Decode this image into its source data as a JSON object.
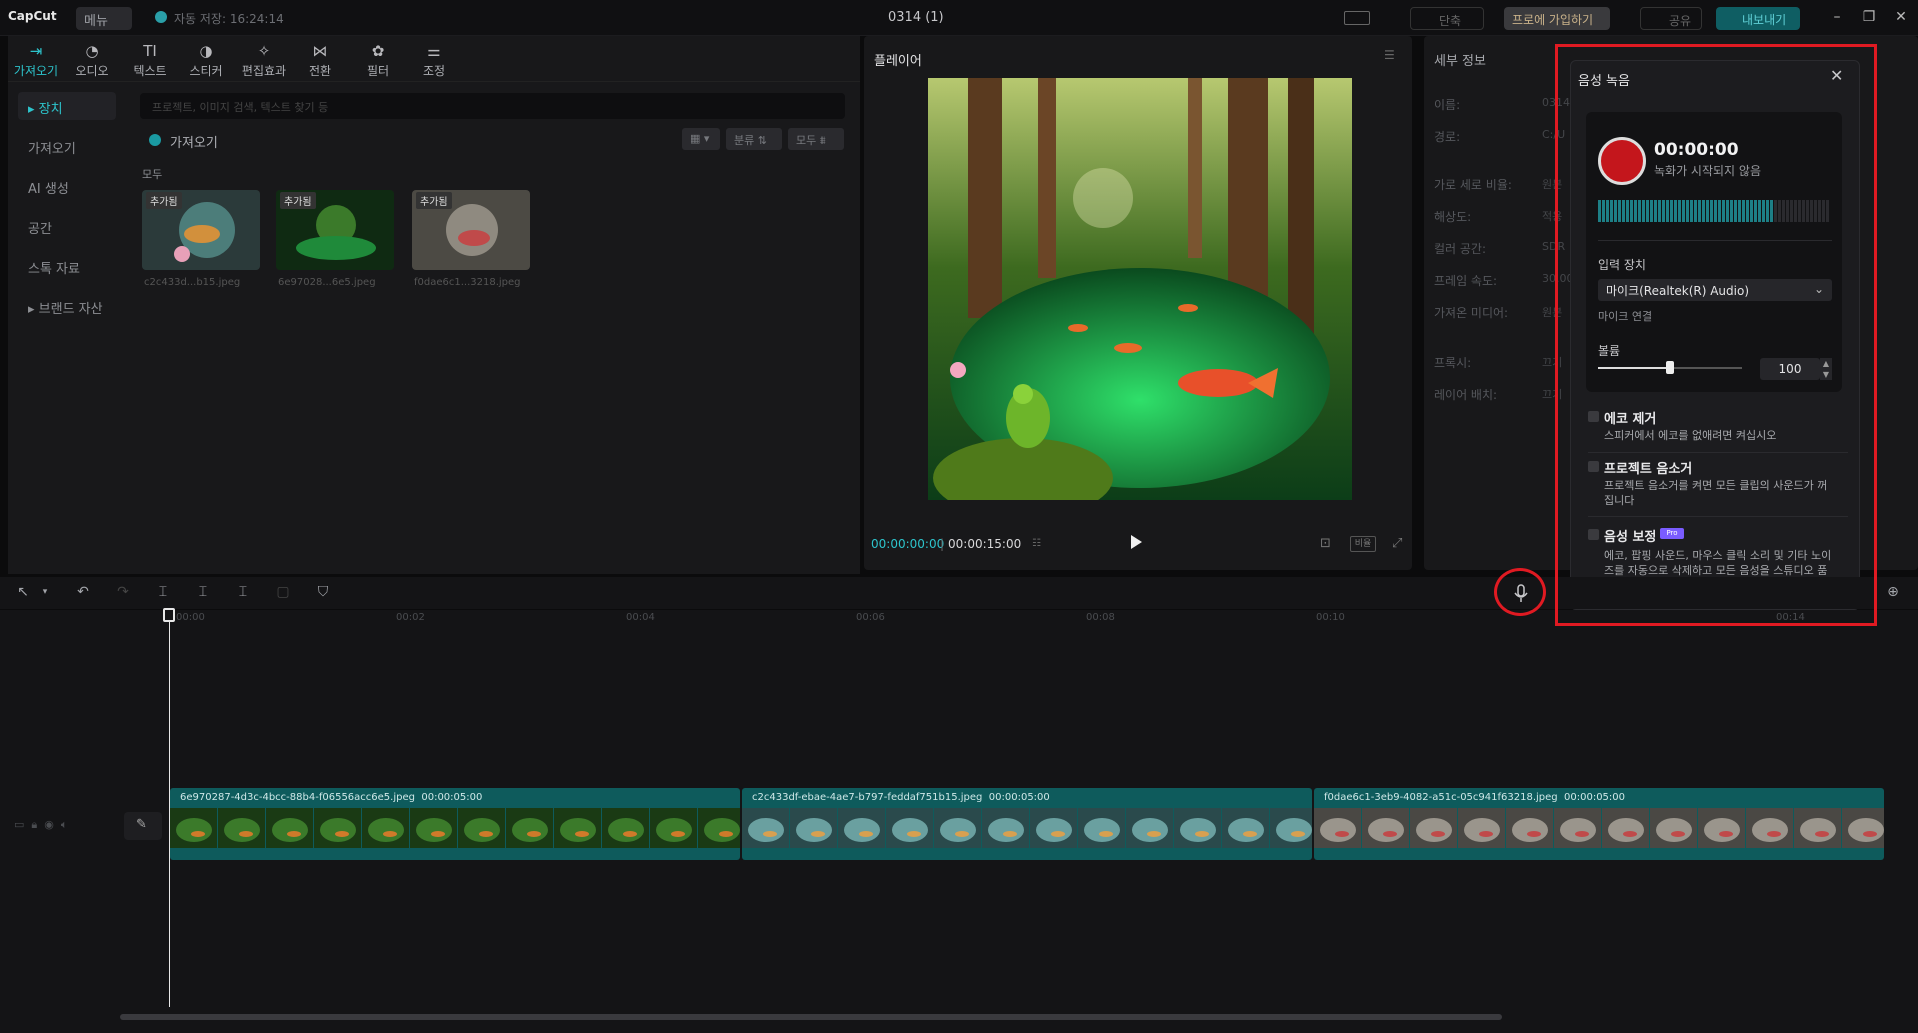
{
  "titlebar": {
    "logo": "CapCut",
    "menu_label": "메뉴",
    "autosave": "자동 저장: 16:24:14",
    "project_title": "0314 (1)",
    "shortcut_label": "단축",
    "pro_label": "프로에 가입하기",
    "share_label": "공유",
    "export_label": "내보내기"
  },
  "toptabs": [
    {
      "label": "가져오기",
      "icon": "import-icon"
    },
    {
      "label": "오디오",
      "icon": "audio-icon"
    },
    {
      "label": "텍스트",
      "icon": "text-icon"
    },
    {
      "label": "스티커",
      "icon": "sticker-icon"
    },
    {
      "label": "편집효과",
      "icon": "effects-icon"
    },
    {
      "label": "전환",
      "icon": "transition-icon"
    },
    {
      "label": "필터",
      "icon": "filter-icon"
    },
    {
      "label": "조정",
      "icon": "adjust-icon"
    }
  ],
  "sidebar": [
    {
      "label": "▸ 장치"
    },
    {
      "label": "가져오기"
    },
    {
      "label": "AI 생성"
    },
    {
      "label": "공간"
    },
    {
      "label": "스톡 자료"
    },
    {
      "label": "▸ 브랜드 자산"
    }
  ],
  "media": {
    "search_placeholder": "프로젝트, 이미지 검색, 텍스트 찾기 등",
    "import_label": "가져오기",
    "sort_label": "분류",
    "filter_label": "모두",
    "all_label": "모두",
    "items": [
      {
        "badge": "추가됨",
        "name": "c2c433d...b15.jpeg"
      },
      {
        "badge": "추가됨",
        "name": "6e97028...6e5.jpeg"
      },
      {
        "badge": "추가됨",
        "name": "f0dae6c1...3218.jpeg"
      }
    ]
  },
  "player": {
    "title": "플레이어",
    "current_time": "00:00:00:00",
    "total_time": "00:00:15:00",
    "ratio_label": "비율"
  },
  "details": {
    "title": "세부 정보",
    "rows": [
      {
        "label": "이름:",
        "value": "0314"
      },
      {
        "label": "경로:",
        "value": "C:/U"
      },
      {
        "label": "가로 세로 비율:",
        "value": "원본"
      },
      {
        "label": "해상도:",
        "value": "적용"
      },
      {
        "label": "컬러 공간:",
        "value": "SDR"
      },
      {
        "label": "프레임 속도:",
        "value": "30.00"
      },
      {
        "label": "가져온 미디어:",
        "value": "원본"
      },
      {
        "label": "프록시:",
        "value": "끄기"
      },
      {
        "label": "레이어 배치:",
        "value": "끄기"
      }
    ]
  },
  "voice_record": {
    "title": "음성 녹음",
    "time": "00:00:00",
    "status": "녹화가 시작되지 않음",
    "input_label": "입력 장치",
    "device": "마이크(Realtek(R) Audio)",
    "mic_link": "마이크 연결",
    "volume_label": "볼륨",
    "volume_value": "100",
    "volume_level": 0.5,
    "options": [
      {
        "title": "에코 제거",
        "desc": "스피커에서 에코를 없애려면 켜십시오"
      },
      {
        "title": "프로젝트 음소거",
        "desc": "프로젝트 음소거를 켜면 모든 클립의 사운드가 꺼집니다"
      },
      {
        "title": "음성 보정",
        "desc": "에코, 팝핑 사운드, 마우스 클릭 소리 및 기타 노이즈를 자동으로 삭제하고 모든 음성을 스튜디오 품질로 보정합니다",
        "badge": "Pro"
      }
    ]
  },
  "timeline": {
    "ticks": [
      "00:00",
      "00:02",
      "00:04",
      "00:06",
      "00:08",
      "00:10",
      "00:14"
    ],
    "clips": [
      {
        "label": "6e970287-4d3c-4bcc-88b4-f06556acc6e5.jpeg",
        "duration": "00:00:05:00"
      },
      {
        "label": "c2c433df-ebae-4ae7-b797-feddaf751b15.jpeg",
        "duration": "00:00:05:00"
      },
      {
        "label": "f0dae6c1-3eb9-4082-a51c-05c941f63218.jpeg",
        "duration": "00:00:05:00"
      }
    ]
  },
  "colors": {
    "accent": "#2dc4cc",
    "record_red": "#c4161c",
    "highlight_red": "#e01a22",
    "clip_teal": "#0e5b5c"
  }
}
